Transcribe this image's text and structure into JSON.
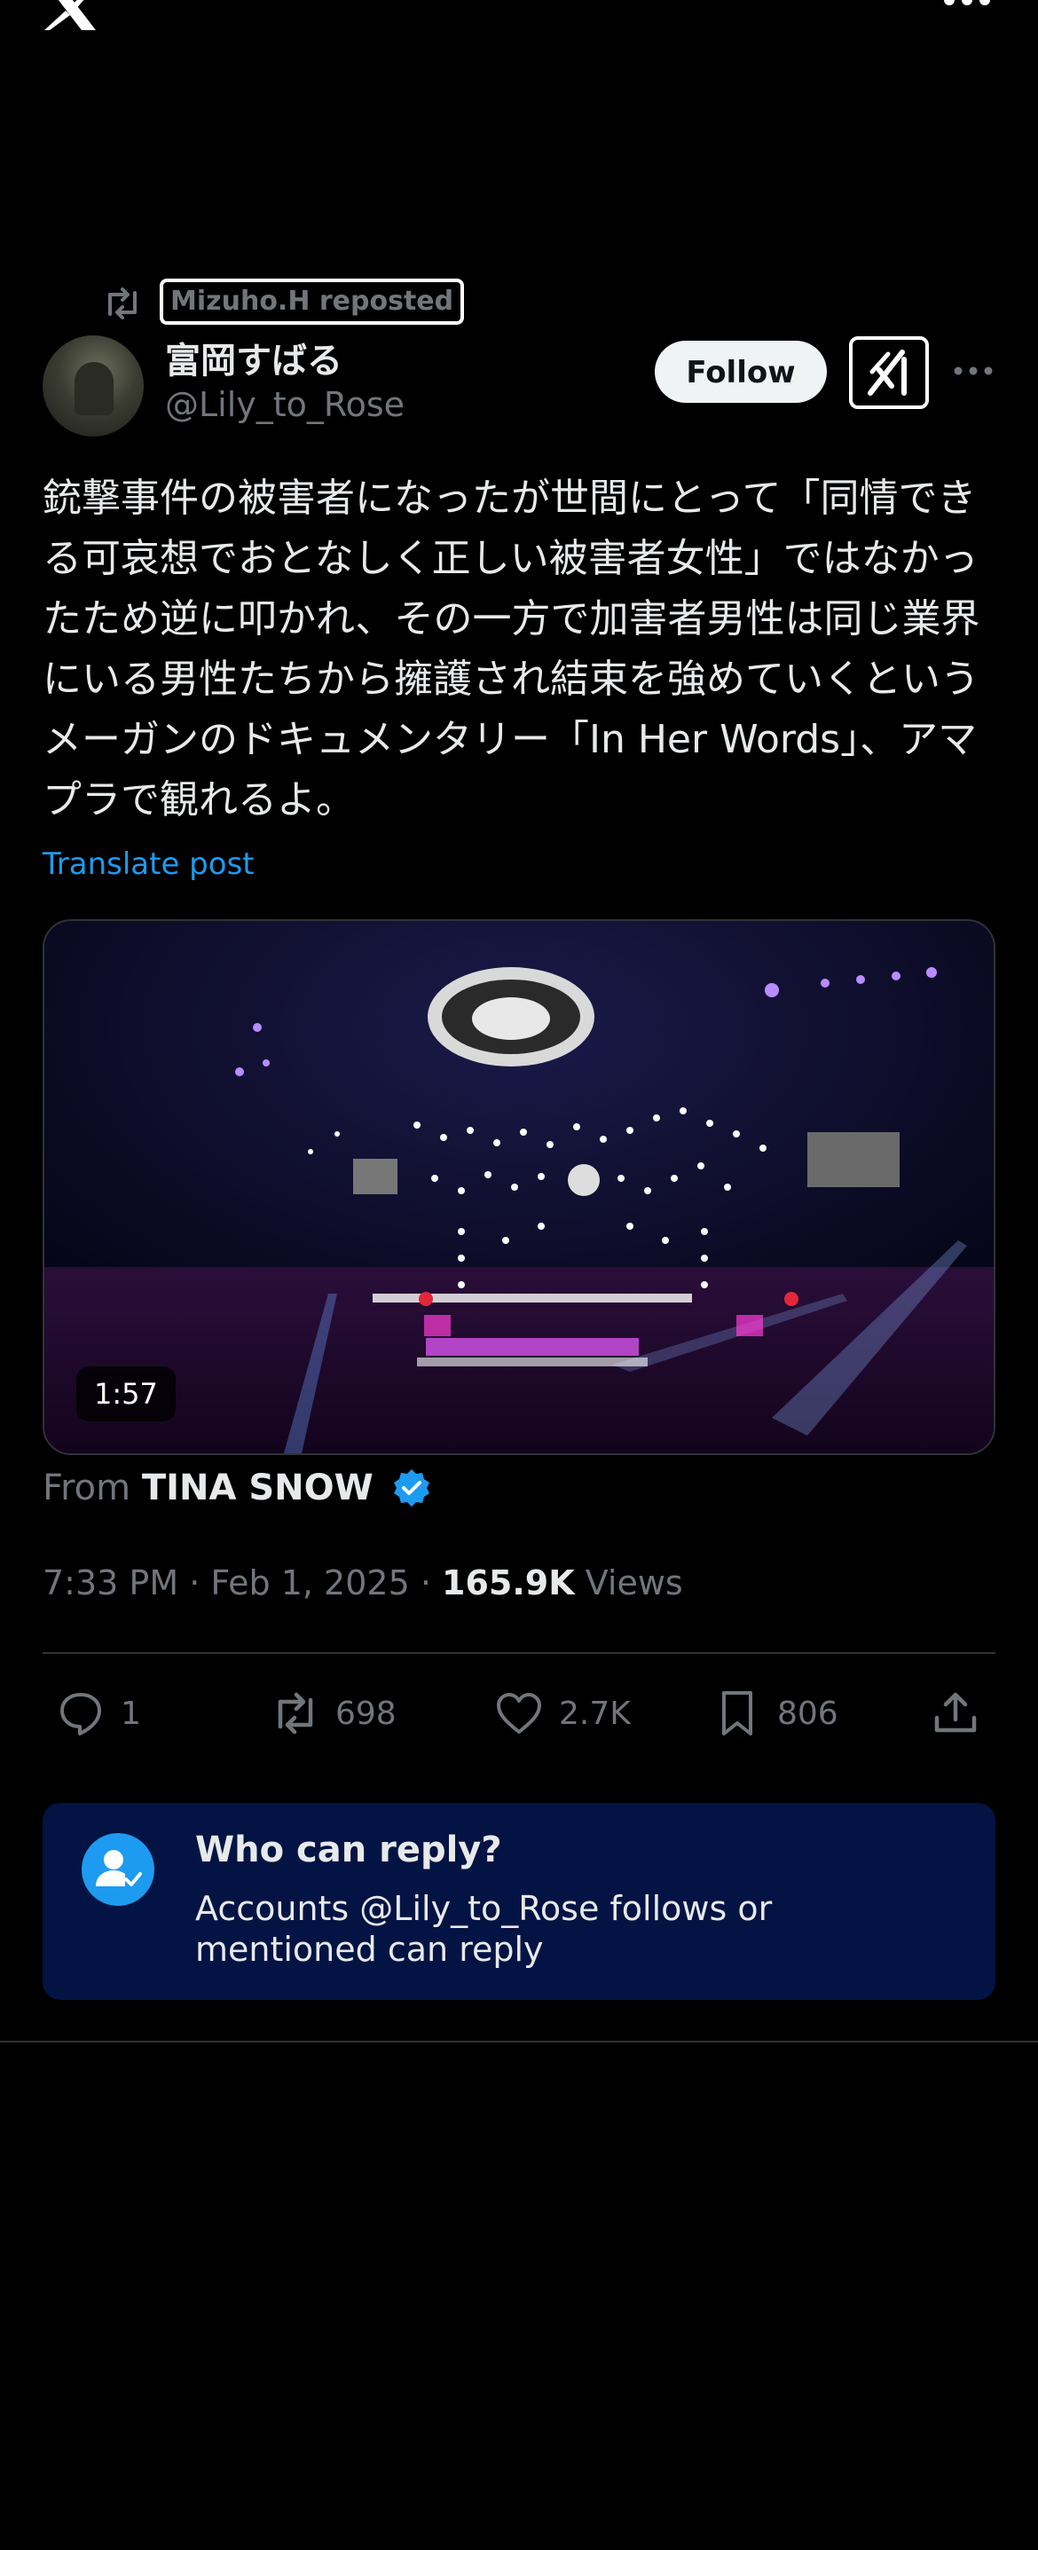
{
  "topbar": {
    "logo_icon": "x-logo-icon",
    "more_icon": "more-horizontal-icon"
  },
  "repost": {
    "label": "Mizuho.H reposted"
  },
  "author": {
    "display_name": "富岡すばる",
    "handle": "@Lily_to_Rose"
  },
  "actions_top": {
    "follow_label": "Follow",
    "grok_icon": "grok-icon"
  },
  "tweet": {
    "text": "銃撃事件の被害者になったが世間にとって「同情できる可哀想でおとなしく正しい被害者女性」ではなかったため逆に叩かれ、その一方で加害者男性は同じ業界にいる男性たちから擁護され結束を強めていくというメーガンのドキュメンタリー「In Her Words」、アマプラで観れるよ。",
    "translate_label": "Translate post"
  },
  "video": {
    "duration": "1:57"
  },
  "source": {
    "prefix": "From",
    "name": "TINA SNOW"
  },
  "meta": {
    "time_date": "7:33 PM · Feb 1, 2025 · ",
    "views_count": "165.9K",
    "views_label": " Views"
  },
  "stats": {
    "replies": "1",
    "reposts": "698",
    "likes": "2.7K",
    "bookmarks": "806"
  },
  "reply_restriction": {
    "title": "Who can reply?",
    "description": "Accounts @Lily_to_Rose follows or mentioned can reply"
  },
  "colors": {
    "accent": "#1d9bf0",
    "background": "#000000",
    "muted": "#71767b",
    "card": "#031444"
  }
}
